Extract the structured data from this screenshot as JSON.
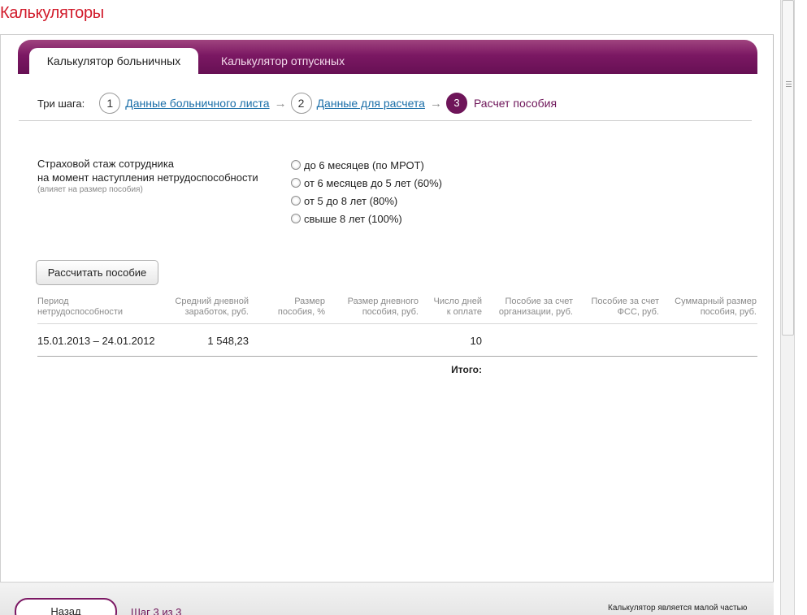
{
  "app": {
    "title": "Калькуляторы"
  },
  "tabs": [
    {
      "label": "Калькулятор больничных",
      "active": true
    },
    {
      "label": "Калькулятор отпускных",
      "active": false
    }
  ],
  "steps": {
    "label": "Три шага:",
    "items": [
      {
        "num": "1",
        "label": "Данные больничного листа",
        "link": true
      },
      {
        "num": "2",
        "label": "Данные для расчета",
        "link": true
      },
      {
        "num": "3",
        "label": "Расчет пособия",
        "current": true
      }
    ],
    "arrow": "→"
  },
  "stazh": {
    "label_line1": "Страховой стаж сотрудника",
    "label_line2": "на момент наступления нетрудоспособности",
    "hint": "(влияет на размер пособия)",
    "options": [
      "до 6 месяцев (по МРОТ)",
      "от 6 месяцев до 5 лет (60%)",
      "от 5 до 8 лет (80%)",
      "свыше 8 лет (100%)"
    ]
  },
  "calculate_button": "Рассчитать пособие",
  "table": {
    "headers": [
      [
        "Период",
        "нетрудоспособности"
      ],
      [
        "Средний дневной",
        "заработок, руб."
      ],
      [
        "Размер",
        "пособия, %"
      ],
      [
        "Размер дневного",
        "пособия, руб."
      ],
      [
        "Число дней",
        "к оплате"
      ],
      [
        "Пособие за счет",
        "организации, руб."
      ],
      [
        "Пособие за счет",
        "ФСС, руб."
      ],
      [
        "Суммарный размер",
        "пособия, руб."
      ]
    ],
    "row": {
      "period": "15.01.2013 – 24.01.2012",
      "avg_earnings": "1 548,23",
      "days": "10"
    },
    "total_label": "Итого:"
  },
  "footer": {
    "back_button": "Назад",
    "step_of": "Шаг 3 из 3",
    "note": "Калькулятор является малой частью"
  },
  "colors": {
    "brand": "#6e1559",
    "title_red": "#d11a2a",
    "link": "#1a6ea8"
  }
}
